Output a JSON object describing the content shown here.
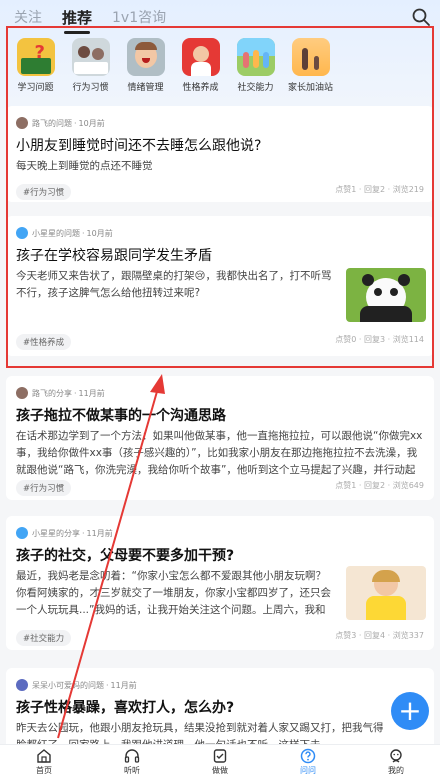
{
  "tabs": [
    {
      "label": "关注"
    },
    {
      "label": "推荐"
    },
    {
      "label": "1v1咨询"
    }
  ],
  "categories": [
    {
      "label": "学习问题",
      "icon": "book-question-icon"
    },
    {
      "label": "行为习惯",
      "icon": "kids-reading-icon"
    },
    {
      "label": "情绪管理",
      "icon": "crying-child-icon"
    },
    {
      "label": "性格养成",
      "icon": "heart-child-icon"
    },
    {
      "label": "社交能力",
      "icon": "kids-group-icon"
    },
    {
      "label": "家长加油站",
      "icon": "parent-child-icon"
    }
  ],
  "posts": [
    {
      "author": "路飞",
      "action": "的问题",
      "time": "10月前",
      "title": "小朋友到睡觉时间还不去睡怎么跟他说?",
      "desc": "每天晚上到睡觉的点还不睡觉",
      "tag": "#行为习惯",
      "stats": "点赞1 · 回复2 · 浏览219"
    },
    {
      "author": "小星星",
      "action": "的问题",
      "time": "10月前",
      "title": "孩子在学校容易跟同学发生矛盾",
      "desc": "今天老师又来告状了，跟隔壁桌的打架😢，我都快出名了，打不听骂不行，孩子这脾气怎么给他扭转过来呢?",
      "tag": "#性格养成",
      "stats": "点赞0 · 回复3 · 浏览114",
      "image": "panda-photo"
    },
    {
      "author": "路飞",
      "action": "的分享",
      "time": "11月前",
      "title": "孩子拖拉不做某事的一个沟通思路",
      "desc": "在话术那边学到了一个方法：如果叫他做某事，他一直拖拖拉拉，可以跟他说“你做完xx事，我给你做件xx事（孩子感兴趣的）”，比如我家小朋友在那边拖拖拉拉不去洗澡，我就跟他说“路飞，你洗完澡，我给你听个故事”，他听到这个立马提起了兴趣，并行动起来...",
      "tag": "#行为习惯",
      "stats": "点赞1 · 回复2 · 浏览649"
    },
    {
      "author": "小星星",
      "action": "的分享",
      "time": "11月前",
      "title": "孩子的社交，父母要不要多加干预?",
      "desc": "最近，我妈老是念叨着：“你家小宝怎么都不爱跟其他小朋友玩啊？你看阿姨家的，才三岁就交了一堆朋友，你家小宝都四岁了，还只会一个人玩玩具...”我妈的话，让我开始关注这个问题。上周六，我和小宝...",
      "tag": "#社交能力",
      "stats": "点赞3 · 回复4 · 浏览337",
      "image": "girl-photo"
    },
    {
      "author": "呆呆小可爱妈",
      "action": "的问题",
      "time": "11月前",
      "title": "孩子性格暴躁，喜欢打人，怎么办?",
      "desc": "昨天去公园玩，他跟小朋友抢玩具，结果没抢到就对着人家又踢又打，把我气得脸都红了。回家路上，我跟他讲道理，他一句话也不听。这样下去..."
    }
  ],
  "fab": {
    "label": "+"
  },
  "bottom_nav": [
    {
      "label": "首页",
      "icon": "home-icon"
    },
    {
      "label": "听听",
      "icon": "headphones-icon"
    },
    {
      "label": "做做",
      "icon": "task-icon"
    },
    {
      "label": "问问",
      "icon": "question-icon",
      "active": true
    },
    {
      "label": "我的",
      "icon": "profile-icon"
    }
  ],
  "colors": {
    "accent": "#2f8cf6",
    "annotation": "#e53935"
  }
}
